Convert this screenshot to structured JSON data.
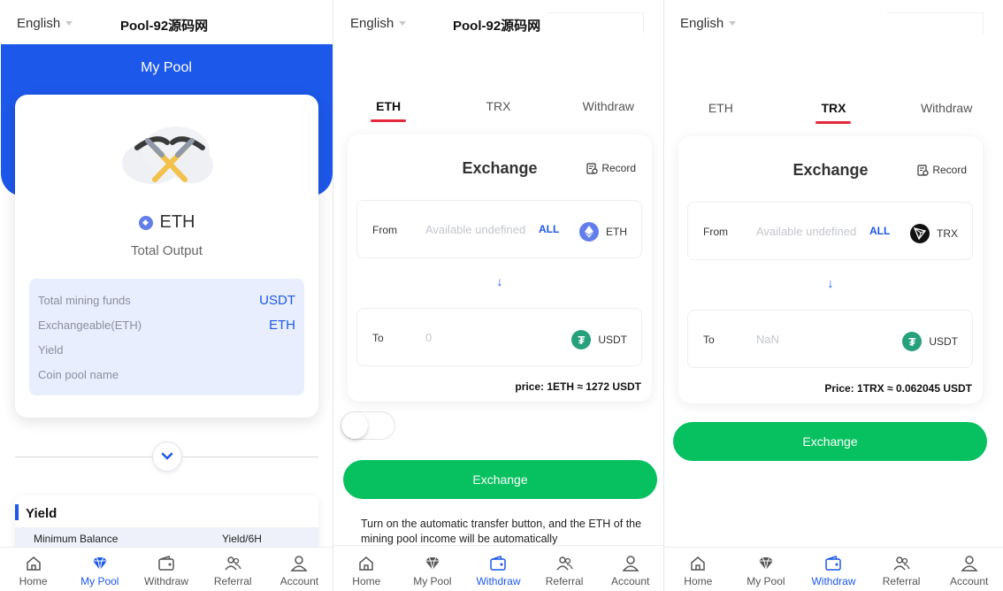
{
  "common": {
    "language": "English",
    "brand": "Pool-92源码网"
  },
  "nav": {
    "home": "Home",
    "mypool": "My Pool",
    "withdraw": "Withdraw",
    "referral": "Referral",
    "account": "Account"
  },
  "panel1": {
    "header_title": "My Pool",
    "coin": "ETH",
    "total_output": "Total Output",
    "stats": [
      {
        "label": "Total mining funds",
        "value": "USDT"
      },
      {
        "label": "Exchangeable(ETH)",
        "value": "ETH"
      },
      {
        "label": "Yield",
        "value": ""
      },
      {
        "label": "Coin pool name",
        "value": ""
      }
    ],
    "yield_title": "Yield",
    "yield_col1": "Minimum Balance",
    "yield_col2": "Yield/6H"
  },
  "panel2": {
    "tabs": [
      "ETH",
      "TRX",
      "Withdraw"
    ],
    "active_tab": "ETH",
    "card_title": "Exchange",
    "record": "Record",
    "from_label": "From",
    "from_placeholder": "Available undefined",
    "all": "ALL",
    "from_symbol": "ETH",
    "arrow": "↓",
    "to_label": "To",
    "to_value": "0",
    "to_symbol": "USDT",
    "price": "price: 1ETH ≈ 1272 USDT",
    "auto_transfer_on": false,
    "button": "Exchange",
    "note": "Turn on the automatic transfer button, and the ETH of the mining pool income will be automatically"
  },
  "panel3": {
    "tabs": [
      "ETH",
      "TRX",
      "Withdraw"
    ],
    "active_tab": "TRX",
    "card_title": "Exchange",
    "record": "Record",
    "from_label": "From",
    "from_placeholder": "Available undefined",
    "all": "ALL",
    "from_symbol": "TRX",
    "arrow": "↓",
    "to_label": "To",
    "to_value": "NaN",
    "to_symbol": "USDT",
    "price": "Price: 1TRX ≈ 0.062045 USDT",
    "button": "Exchange"
  },
  "colors": {
    "primary": "#1c58ea",
    "green": "#07c160",
    "tab_underline": "#e5283b",
    "eth": "#627eea",
    "usdt": "#26a17b"
  }
}
